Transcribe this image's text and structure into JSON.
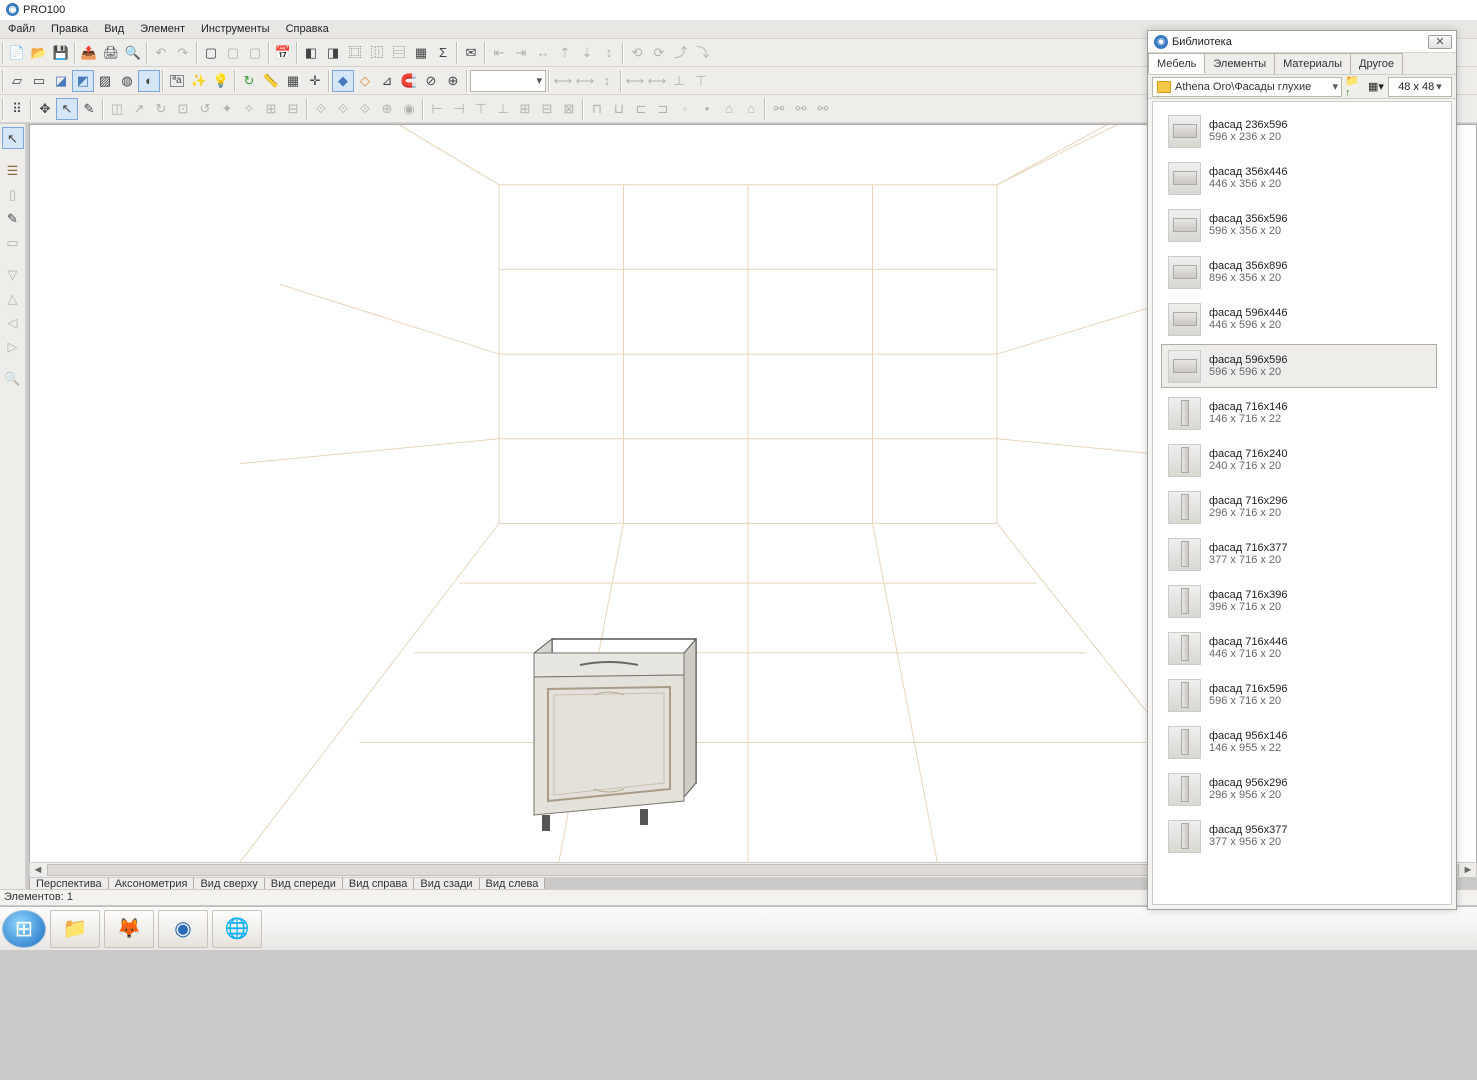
{
  "title": "PRO100",
  "menu": {
    "file": "Файл",
    "edit": "Правка",
    "view": "Вид",
    "element": "Элемент",
    "tools": "Инструменты",
    "help": "Справка"
  },
  "view_tabs": [
    "Перспектива",
    "Аксонометрия",
    "Вид сверху",
    "Вид спереди",
    "Вид справа",
    "Вид сзади",
    "Вид слева"
  ],
  "status": "Элементов: 1",
  "library": {
    "title": "Библиотека",
    "tabs": [
      "Мебель",
      "Элементы",
      "Материалы",
      "Другое"
    ],
    "active_tab": 0,
    "path": "Athena Oro\\Фасады глухие",
    "thumb_size": "48 x  48",
    "items": [
      {
        "name": "фасад 236x596",
        "dims": "596 x 236 x 20",
        "tall": false
      },
      {
        "name": "фасад 356x446",
        "dims": "446 x 356 x 20",
        "tall": false
      },
      {
        "name": "фасад 356x596",
        "dims": "596 x 356 x 20",
        "tall": false
      },
      {
        "name": "фасад 356x896",
        "dims": "896 x 356 x 20",
        "tall": false
      },
      {
        "name": "фасад 596x446",
        "dims": "446 x 596 x 20",
        "tall": false
      },
      {
        "name": "фасад 596x596",
        "dims": "596 x 596 x 20",
        "tall": false,
        "selected": true
      },
      {
        "name": "фасад 716x146",
        "dims": "146 x 716 x 22",
        "tall": true
      },
      {
        "name": "фасад 716x240",
        "dims": "240 x 716 x 20",
        "tall": true
      },
      {
        "name": "фасад 716x296",
        "dims": "296 x 716 x 20",
        "tall": true
      },
      {
        "name": "фасад 716x377",
        "dims": "377 x 716 x 20",
        "tall": true
      },
      {
        "name": "фасад 716x396",
        "dims": "396 x 716 x 20",
        "tall": true
      },
      {
        "name": "фасад 716x446",
        "dims": "446 x 716 x 20",
        "tall": true
      },
      {
        "name": "фасад 716x596",
        "dims": "596 x 716 x 20",
        "tall": true
      },
      {
        "name": "фасад 956x146",
        "dims": "146 x 955 x 22",
        "tall": true
      },
      {
        "name": "фасад 956x296",
        "dims": "296 x 956 x 20",
        "tall": true
      },
      {
        "name": "фасад 956x377",
        "dims": "377 x 956 x 20",
        "tall": true
      }
    ]
  }
}
